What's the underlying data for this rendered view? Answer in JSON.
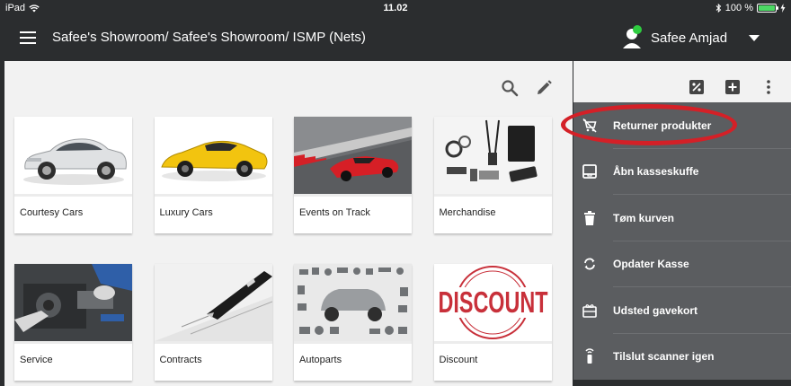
{
  "status_bar": {
    "device": "iPad",
    "time": "11.02",
    "battery": "100 %",
    "battery_level": 1.0
  },
  "header": {
    "title": "Safee's Showroom/ Safee's Showroom/ ISMP (Nets)",
    "user_name": "Safee Amjad",
    "online_color": "#2ecc40"
  },
  "tiles": [
    {
      "label": "Courtesy Cars",
      "image": "white-sedan"
    },
    {
      "label": "Luxury Cars",
      "image": "yellow-supercar"
    },
    {
      "label": "Events on Track",
      "image": "red-sports-car-on-track"
    },
    {
      "label": "Merchandise",
      "image": "branded-merchandise"
    },
    {
      "label": "Service",
      "image": "mechanic-engine"
    },
    {
      "label": "Contracts",
      "image": "contract-pen"
    },
    {
      "label": "Autoparts",
      "image": "car-parts-layout"
    },
    {
      "label": "Discount",
      "image": "discount-stamp",
      "image_text": "DISCOUNT"
    }
  ],
  "menu": [
    {
      "label": "Returner produkter",
      "icon": "remove-cart-icon"
    },
    {
      "label": "Åbn kasseskuffe",
      "icon": "cash-drawer-icon"
    },
    {
      "label": "Tøm kurven",
      "icon": "trash-icon"
    },
    {
      "label": "Opdater Kasse",
      "icon": "refresh-icon"
    },
    {
      "label": "Udsted gavekort",
      "icon": "gift-card-icon"
    },
    {
      "label": "Tilslut scanner igen",
      "icon": "scanner-icon"
    }
  ],
  "colors": {
    "accent": "#d42027",
    "menu_bg": "#5b5d60",
    "header_bg": "#2b2d2f",
    "content_bg": "#f2f2f2"
  }
}
